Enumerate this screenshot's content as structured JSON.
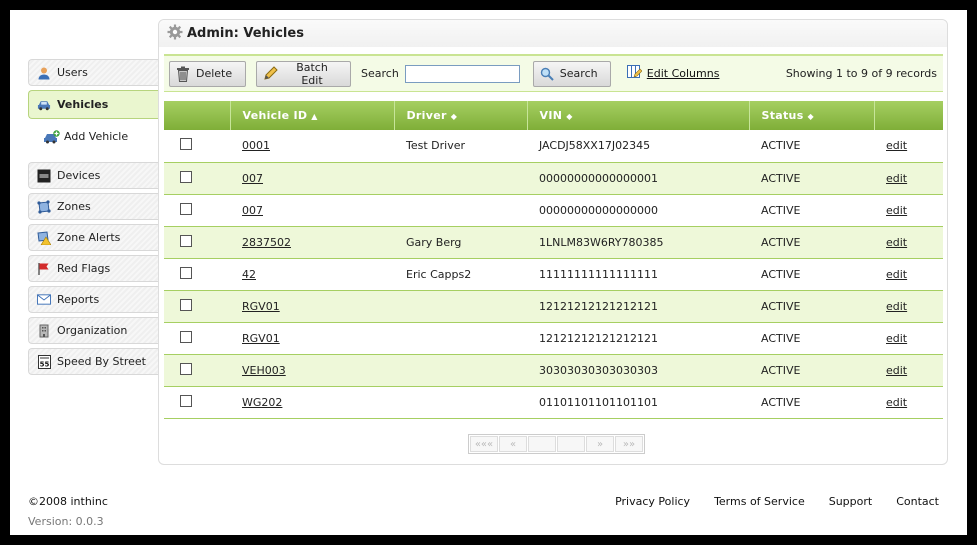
{
  "sidebar": {
    "items": [
      {
        "label": "Users",
        "icon": "user-icon"
      },
      {
        "label": "Vehicles",
        "icon": "car-icon",
        "active": true
      },
      {
        "label": "Add Vehicle",
        "icon": "add-vehicle-icon",
        "sub": true
      },
      {
        "label": "Devices",
        "icon": "device-icon"
      },
      {
        "label": "Zones",
        "icon": "zones-icon"
      },
      {
        "label": "Zone Alerts",
        "icon": "zone-alert-icon"
      },
      {
        "label": "Red Flags",
        "icon": "red-flag-icon"
      },
      {
        "label": "Reports",
        "icon": "envelope-icon"
      },
      {
        "label": "Organization",
        "icon": "organization-icon"
      },
      {
        "label": "Speed By Street",
        "icon": "speed-sign-icon"
      }
    ]
  },
  "panel": {
    "title": "Admin: Vehicles"
  },
  "toolbar": {
    "delete_label": "Delete",
    "batch_edit_label": "Batch Edit",
    "search_label": "Search",
    "search_value": "",
    "search_button_label": "Search",
    "edit_columns_label": "Edit Columns",
    "showing_text": "Showing 1 to 9 of 9 records"
  },
  "table": {
    "headers": {
      "vehicle_id": "Vehicle ID",
      "driver": "Driver",
      "vin": "VIN",
      "status": "Status",
      "vehicle_id_sort": "▲",
      "driver_sort": "◆",
      "vin_sort": "◆",
      "status_sort": "◆"
    },
    "rows": [
      {
        "id": "0001",
        "driver": "Test Driver",
        "vin": "JACDJ58XX17J02345",
        "status": "ACTIVE",
        "action": "edit"
      },
      {
        "id": "007",
        "driver": "",
        "vin": "00000000000000001",
        "status": "ACTIVE",
        "action": "edit"
      },
      {
        "id": "007",
        "driver": "",
        "vin": "00000000000000000",
        "status": "ACTIVE",
        "action": "edit"
      },
      {
        "id": "2837502",
        "driver": "Gary Berg",
        "vin": "1LNLM83W6RY780385",
        "status": "ACTIVE",
        "action": "edit"
      },
      {
        "id": "42",
        "driver": "Eric Capps2",
        "vin": "11111111111111111",
        "status": "ACTIVE",
        "action": "edit"
      },
      {
        "id": "RGV01",
        "driver": "",
        "vin": "12121212121212121",
        "status": "ACTIVE",
        "action": "edit"
      },
      {
        "id": "RGV01",
        "driver": "",
        "vin": "12121212121212121",
        "status": "ACTIVE",
        "action": "edit"
      },
      {
        "id": "VEH003",
        "driver": "",
        "vin": "30303030303030303",
        "status": "ACTIVE",
        "action": "edit"
      },
      {
        "id": "WG202",
        "driver": "",
        "vin": "01101101101101101",
        "status": "ACTIVE",
        "action": "edit"
      }
    ]
  },
  "pager": {
    "first": "«««",
    "prev": "«",
    "page_a": "",
    "page_b": "",
    "next": "»",
    "last": "»»"
  },
  "footer": {
    "copyright": "©2008 inthinc",
    "version": "Version: 0.0.3",
    "links": [
      "Privacy Policy",
      "Terms of Service",
      "Support",
      "Contact"
    ]
  },
  "colors": {
    "accent_green": "#8dbb45",
    "row_alt": "#eef8d9",
    "active_nav": "#eaf6cf"
  }
}
